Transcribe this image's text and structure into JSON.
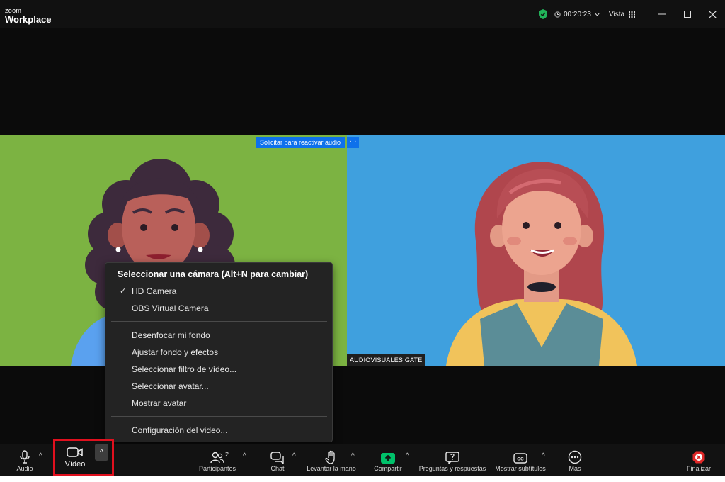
{
  "app": {
    "brand_small": "zoom",
    "brand_name": "Workplace"
  },
  "titlebar": {
    "timer": "00:20:23",
    "view_label": "Vista"
  },
  "meeting": {
    "unmute_request": "Solicitar para reactivar audio",
    "more_glyph": "···",
    "participant_name": "AUDIOVISUALES GATE"
  },
  "camera_menu": {
    "header": "Seleccionar una cámara (Alt+N para cambiar)",
    "cameras": [
      {
        "label": "HD Camera",
        "selected": true
      },
      {
        "label": "OBS Virtual Camera",
        "selected": false
      }
    ],
    "options": [
      "Desenfocar mi fondo",
      "Ajustar fondo y efectos",
      "Seleccionar filtro de vídeo...",
      "Seleccionar avatar...",
      "Mostrar avatar"
    ],
    "settings": "Configuración del video..."
  },
  "toolbar": {
    "audio": "Audio",
    "video": "Vídeo",
    "participants": "Participantes",
    "participants_count": "2",
    "chat": "Chat",
    "raise_hand": "Levantar la mano",
    "share": "Compartir",
    "qa": "Preguntas y respuestas",
    "captions": "Mostrar subtítulos",
    "more": "Más",
    "end": "Finalizar"
  },
  "colors": {
    "accent_blue": "#0e71eb",
    "highlight_red": "#e0101e",
    "share_green": "#00c16a",
    "end_red": "#e02828",
    "secure_green": "#22b45a"
  }
}
